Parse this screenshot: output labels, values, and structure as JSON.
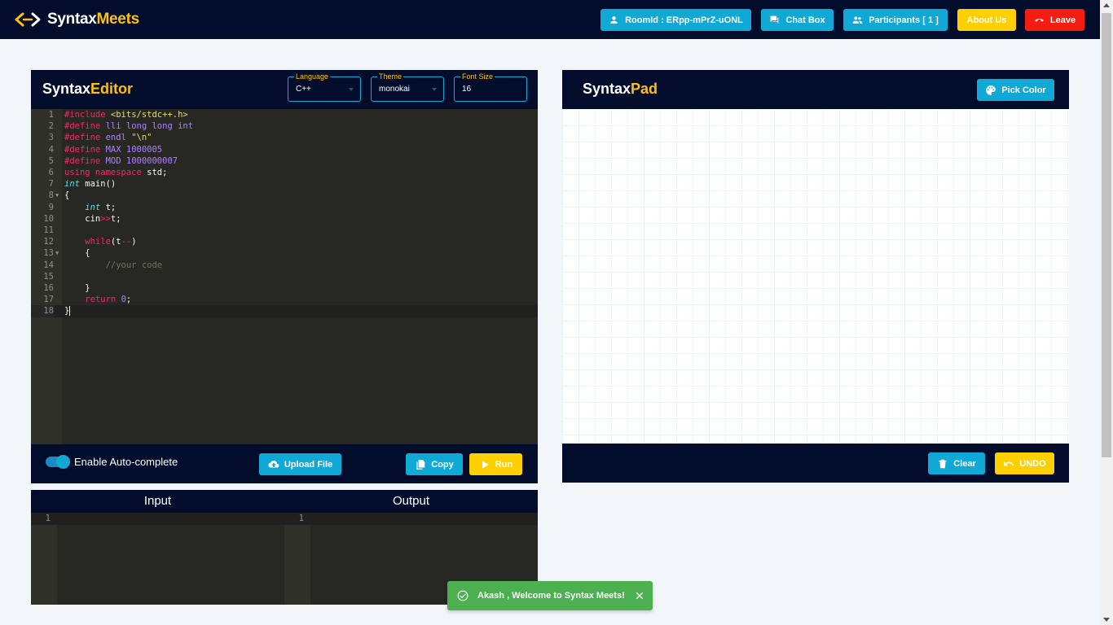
{
  "navbar": {
    "brand_first": "Syntax",
    "brand_second": "Meets",
    "room_id_label": "RoomId : ERpp-mPrZ-uONL",
    "chat_box_label": "Chat Box",
    "participants_label": "Participants [ 1 ]",
    "about_label": "About Us",
    "leave_label": "Leave"
  },
  "editor": {
    "title_first": "Syntax",
    "title_second": "Editor",
    "language": {
      "legend": "Language",
      "value": "C++"
    },
    "theme": {
      "legend": "Theme",
      "value": "monokai"
    },
    "font_size": {
      "legend": "Font Size",
      "value": "16"
    },
    "line_numbers": [
      "1",
      "2",
      "3",
      "4",
      "5",
      "6",
      "7",
      "8",
      "9",
      "10",
      "11",
      "12",
      "13",
      "14",
      "15",
      "16",
      "17",
      "18"
    ],
    "code_lines": [
      "#include <bits/stdc++.h>",
      "#define lli long long int",
      "#define endl \"\\n\"",
      "#define MAX 1000005",
      "#define MOD 1000000007",
      "using namespace std;",
      "int main()",
      "{",
      "    int t;",
      "    cin>>t;",
      "",
      "    while(t--)",
      "    {",
      "        //your code",
      "",
      "    }",
      "    return 0;",
      "}"
    ],
    "autocomplete_label": "Enable Auto-complete",
    "upload_label": "Upload File",
    "copy_label": "Copy",
    "run_label": "Run"
  },
  "io": {
    "input_title": "Input",
    "output_title": "Output",
    "input_line_number": "1",
    "output_line_number": "1"
  },
  "pad": {
    "title_first": "Syntax",
    "title_second": "Pad",
    "pick_color_label": "Pick Color",
    "clear_label": "Clear",
    "undo_label": "UNDO"
  },
  "toast": {
    "message": "Akash , Welcome to Syntax Meets!"
  },
  "colors": {
    "navy": "#020d2b",
    "cyan": "#10a9d6",
    "yellow": "#ffd000",
    "red": "#f51d12",
    "toast_green": "#4caf50"
  }
}
